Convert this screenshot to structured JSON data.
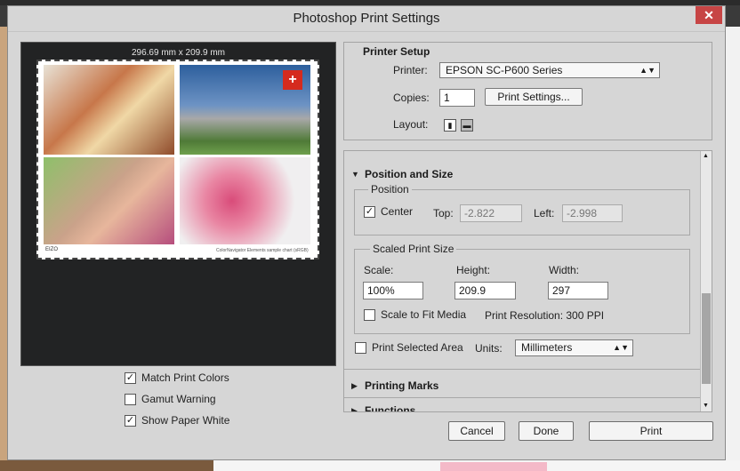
{
  "window": {
    "title": "Photoshop Print Settings",
    "close_glyph": "✕"
  },
  "preview": {
    "dimensions": "296.69 mm x 209.9 mm",
    "logo": "EIZO",
    "sample_label": "ColorNavigator Elements sample chart (sRGB)",
    "flag_glyph": "+"
  },
  "preview_options": {
    "match_print_colors": {
      "label": "Match Print Colors",
      "checked": true
    },
    "gamut_warning": {
      "label": "Gamut Warning",
      "checked": false
    },
    "show_paper_white": {
      "label": "Show Paper White",
      "checked": true
    }
  },
  "printer_setup": {
    "title": "Printer Setup",
    "printer_label": "Printer:",
    "printer_value": "EPSON SC-P600 Series",
    "copies_label": "Copies:",
    "copies_value": "1",
    "print_settings_button": "Print Settings...",
    "layout_label": "Layout:",
    "layout_icons": [
      "portrait-icon",
      "landscape-icon"
    ]
  },
  "position_size": {
    "title": "Position and Size",
    "position_group": "Position",
    "center_label": "Center",
    "center_checked": true,
    "top_label": "Top:",
    "top_value": "-2.822",
    "left_label": "Left:",
    "left_value": "-2.998",
    "scaled_group": "Scaled Print Size",
    "scale_label": "Scale:",
    "scale_value": "100%",
    "height_label": "Height:",
    "height_value": "209.9",
    "width_label": "Width:",
    "width_value": "297",
    "scale_to_fit_label": "Scale to Fit Media",
    "scale_to_fit_checked": false,
    "print_resolution": "Print Resolution: 300 PPI",
    "print_selected_area_label": "Print Selected Area",
    "print_selected_area_checked": false,
    "units_label": "Units:",
    "units_value": "Millimeters"
  },
  "sections": {
    "printing_marks": "Printing Marks",
    "functions": "Functions"
  },
  "buttons": {
    "cancel": "Cancel",
    "done": "Done",
    "print": "Print"
  }
}
